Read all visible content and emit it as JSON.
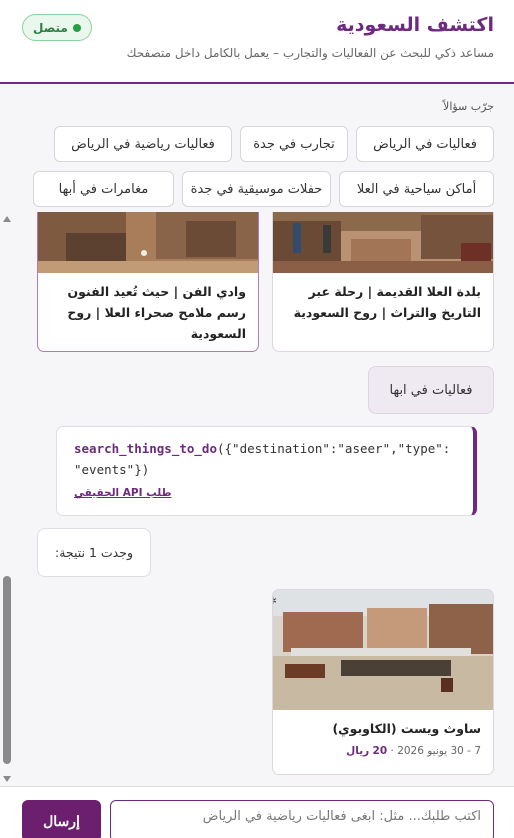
{
  "header": {
    "title": "اكتشف السعودية",
    "subtitle": "مساعد ذكي للبحث عن الفعاليات والتجارب – يعمل بالكامل داخل متصفحك",
    "status": "متصل"
  },
  "suggestions": {
    "title": "جرّب سؤالاً",
    "chips": [
      "فعاليات في الرياض",
      "تجارب في جدة",
      "فعاليات رياضية في الرياض",
      "أماكن سياحية في العلا",
      "حفلات موسيقية في جدة",
      "مغامرات في أبها"
    ]
  },
  "chat": {
    "cards": [
      {
        "title": "بلدة العلا القديمة | رحلة عبر التاريخ والتراث | روح السعودية"
      },
      {
        "title": "وادي الفن | حيث تُعيد الفنون رسم ملامح صحراء العلا | روح السعودية"
      }
    ],
    "user_message": "فعاليات في ابها",
    "tool_call": {
      "function": "search_things_to_do",
      "args_line1": "({\"destination\":\"aseer\",\"type\":",
      "args_line2": "\"events\"})",
      "link_label": "طلب API الحقيقي"
    },
    "result_count": "وجدت 1 نتيجة:",
    "event": {
      "title": "ساوث ويست (الكاوبوي)",
      "dates": "7 - 30 يونيو 2026",
      "separator": "·",
      "price_value": "20",
      "price_currency": "ريال"
    }
  },
  "composer": {
    "placeholder": "اكتب طلبك... مثل: ابغى فعاليات رياضية في الرياض",
    "send_label": "إرسال"
  },
  "colors": {
    "brand": "#6d2a7e",
    "status_green": "#23a046"
  }
}
